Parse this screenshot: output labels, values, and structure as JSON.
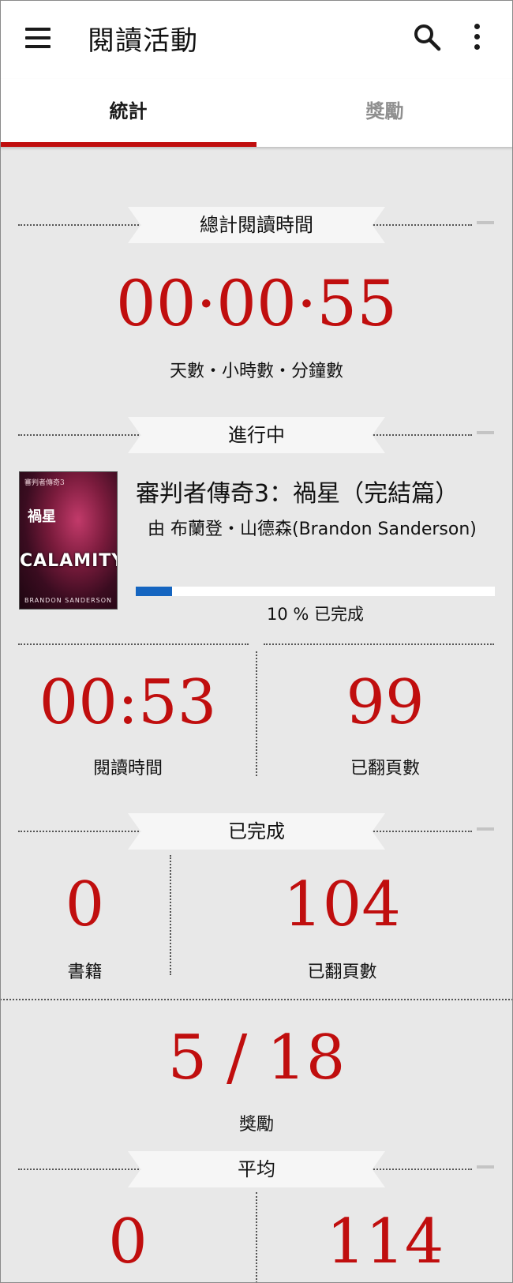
{
  "app": {
    "title": "閱讀活動",
    "icons": {
      "menu": "menu-icon",
      "search": "search-icon",
      "more": "more-vert-icon"
    }
  },
  "tabs": [
    {
      "label": "統計",
      "active": true
    },
    {
      "label": "獎勵",
      "active": false
    }
  ],
  "colors": {
    "accent": "#c00e0e",
    "progress": "#1565c0",
    "background": "#e8e8e8"
  },
  "total_time": {
    "heading": "總計閱讀時間",
    "value": "00·00·55",
    "caption": "天數・小時數・分鐘數"
  },
  "in_progress": {
    "heading": "進行中",
    "book": {
      "title": "審判者傳奇3：禍星（完結篇）",
      "author": "由 布蘭登・山德森(Brandon Sanderson)",
      "cover": {
        "series": "審判者傳奇3",
        "title": "禍星",
        "big": "CALAMITY",
        "author": "BRANDON SANDERSON"
      },
      "progress_fraction": 0.1,
      "progress_text": "10 % 已完成"
    },
    "reading_time": {
      "value": "00:53",
      "label": "閱讀時間"
    },
    "pages_turned": {
      "value": "99",
      "label": "已翻頁數"
    }
  },
  "completed": {
    "heading": "已完成",
    "books": {
      "value": "0",
      "label": "書籍"
    },
    "pages_turned": {
      "value": "104",
      "label": "已翻頁數"
    }
  },
  "awards": {
    "value": "5 / 18",
    "label": "獎勵"
  },
  "average": {
    "heading": "平均",
    "left_value": "0",
    "right_value": "114"
  }
}
